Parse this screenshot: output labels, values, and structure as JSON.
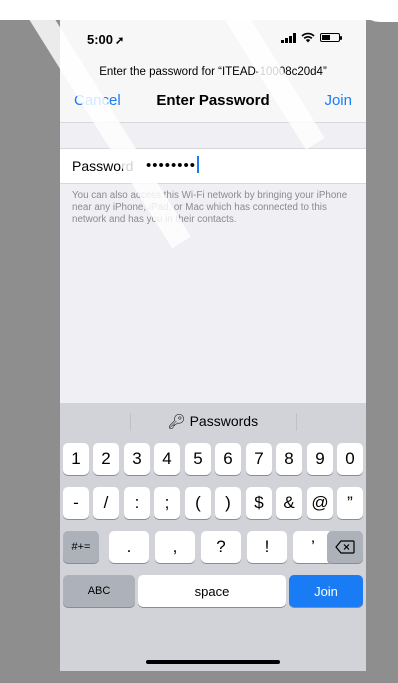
{
  "status_bar": {
    "time": "5:00",
    "location_arrow": "location-arrow-icon"
  },
  "header": {
    "prompt": "Enter the password for “ITEAD-10008c20d4”",
    "cancel": "Cancel",
    "title": "Enter Password",
    "join": "Join"
  },
  "password_field": {
    "label": "Password",
    "value": "••••••••"
  },
  "footnote": "You can also access this Wi-Fi network by bringing your iPhone near any iPhone, iPad, or Mac which has connected to this network and has you in their contacts.",
  "keyboard": {
    "suggestion": "Passwords",
    "row1": [
      "1",
      "2",
      "3",
      "4",
      "5",
      "6",
      "7",
      "8",
      "9",
      "0"
    ],
    "row2": [
      "-",
      "/",
      ":",
      ";",
      "(",
      ")",
      "$",
      "&",
      "@",
      "”"
    ],
    "row3": {
      "shift": "#+=",
      "keys": [
        ".",
        ",",
        "?",
        "!",
        "’"
      ],
      "delete": "delete-icon"
    },
    "row4": {
      "abc": "ABC",
      "space": "space",
      "join": "Join"
    }
  },
  "colors": {
    "accent": "#1a7cf5",
    "keyboard_bg": "#d1d3d9",
    "page_bg": "#efeff4"
  }
}
